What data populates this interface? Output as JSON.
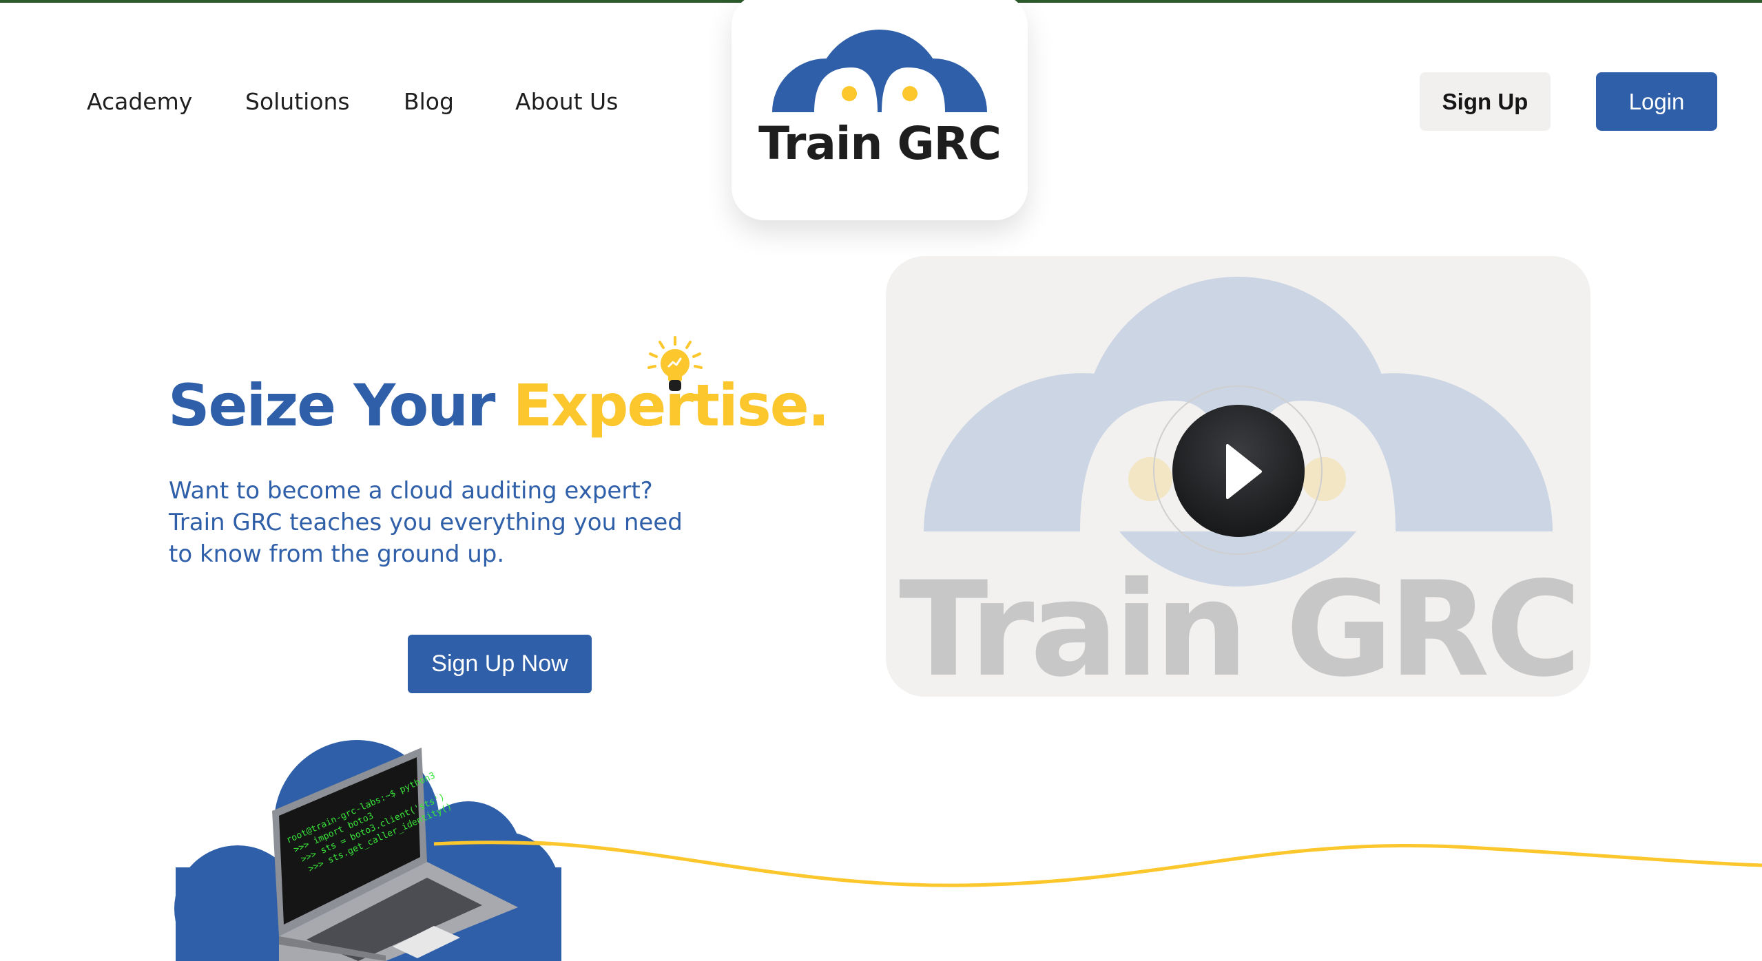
{
  "nav": {
    "items": [
      {
        "label": "Academy"
      },
      {
        "label": "Solutions"
      },
      {
        "label": "Blog"
      },
      {
        "label": "About Us"
      }
    ]
  },
  "brand": {
    "name": "Train GRC",
    "primary_color": "#2e5fa8",
    "accent_color": "#fbc72d",
    "dark_color": "#1e1e1e"
  },
  "auth": {
    "signup_label": "Sign Up",
    "login_label": "Login"
  },
  "hero": {
    "title_part1": "Seize Your ",
    "title_part2": "Expertise.",
    "subtitle_lines": [
      "Want to become a cloud auditing expert?",
      "Train GRC teaches you everything you need",
      "to know from the ground up."
    ],
    "cta_label": "Sign Up Now",
    "icon": "lightbulb-icon"
  },
  "video": {
    "watermark": "Train GRC",
    "play_icon": "play-icon"
  },
  "laptop_screen": {
    "lines": [
      "root@train-grc-labs:~$ python3",
      ">>> import boto3",
      ">>> sts = boto3.client('sts')",
      ">>> sts.get_caller_identity()"
    ],
    "text_color": "#39e639"
  }
}
